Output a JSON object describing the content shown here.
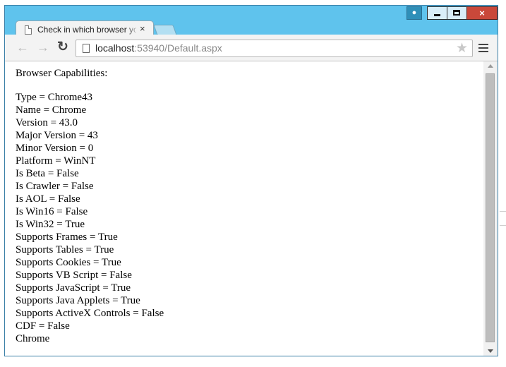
{
  "tab": {
    "title": "Check in which browser your",
    "close_glyph": "×"
  },
  "window_controls": {
    "user_icon": "user-icon",
    "minimize": "minimize-icon",
    "maximize": "maximize-icon",
    "close_glyph": "×"
  },
  "toolbar": {
    "back_glyph": "←",
    "forward_glyph": "→",
    "reload_glyph": "↻",
    "url_host": "localhost",
    "url_rest": ":53940/Default.aspx",
    "star_glyph": "★"
  },
  "page": {
    "heading": "Browser Capabilities:",
    "lines": [
      "Type = Chrome43",
      "Name = Chrome",
      "Version = 43.0",
      "Major Version = 43",
      "Minor Version = 0",
      "Platform = WinNT",
      "Is Beta = False",
      "Is Crawler = False",
      "Is AOL = False",
      "Is Win16 = False",
      "Is Win32 = True",
      "Supports Frames = True",
      "Supports Tables = True",
      "Supports Cookies = True",
      "Supports VB Script = False",
      "Supports JavaScript = True",
      "Supports Java Applets = True",
      "Supports ActiveX Controls = False",
      "CDF = False",
      "Chrome"
    ]
  },
  "colors": {
    "frame": "#5fc3ed",
    "close_button": "#c9483a",
    "tab_background": "#f3f3f3"
  }
}
